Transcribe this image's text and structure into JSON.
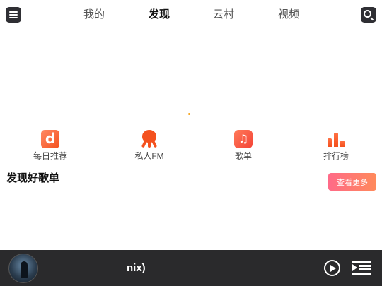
{
  "header": {
    "tabs": [
      {
        "label": "我的",
        "active": false
      },
      {
        "label": "发现",
        "active": true
      },
      {
        "label": "云村",
        "active": false
      },
      {
        "label": "视频",
        "active": false
      }
    ],
    "menu_icon": "menu-icon",
    "search_icon": "search-icon"
  },
  "quick_entries": [
    {
      "label": "每日推荐",
      "icon": "daily-recommend-icon",
      "glyph": "d"
    },
    {
      "label": "私人FM",
      "icon": "octopus-fm-icon"
    },
    {
      "label": "歌单",
      "icon": "music-note-icon",
      "glyph": "♫"
    },
    {
      "label": "排行榜",
      "icon": "bar-chart-icon"
    }
  ],
  "section": {
    "title": "发现好歌单",
    "more_label": "查看更多"
  },
  "player": {
    "song_title": "nix)",
    "cover_icon": "album-cover",
    "play_icon": "play-icon",
    "playlist_icon": "playlist-icon"
  },
  "colors": {
    "accent": "#f4511e",
    "button_gradient_start": "#ff6a88",
    "button_gradient_end": "#ff8a5b",
    "player_bg": "#2a2a2c"
  }
}
